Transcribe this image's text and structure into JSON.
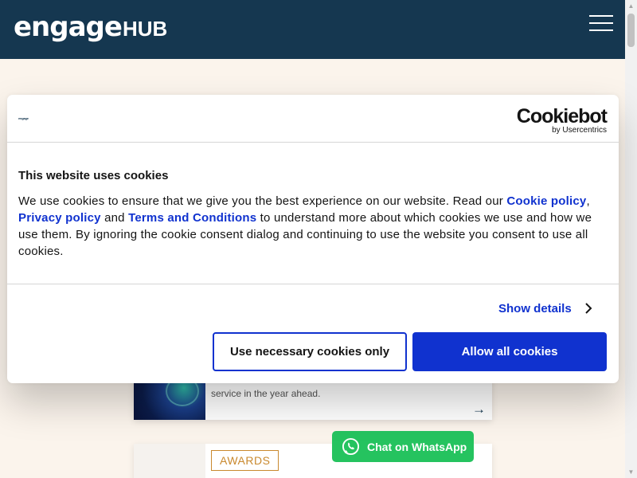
{
  "header": {
    "logo_main": "engage",
    "logo_hub": "HUB",
    "menu_icon": "hamburger-menu-icon"
  },
  "background": {
    "article_excerpt": "service in the year ahead.",
    "article_arrow": "→",
    "award_badge": "AWARDS"
  },
  "whatsapp": {
    "label": "Chat on WhatsApp",
    "icon": "whatsapp-icon",
    "color": "#25c35f"
  },
  "cookie_dialog": {
    "mini_logo": "engage",
    "brand_name": "Cookiebot",
    "brand_sub": "by Usercentrics",
    "title": "This website uses cookies",
    "text_intro": "We use cookies to ensure that we give you the best experience on our website. Read our ",
    "link_cookie_policy": "Cookie policy",
    "sep_comma": ", ",
    "link_privacy_policy": "Privacy policy",
    "sep_and": " and ",
    "link_terms": "Terms and Conditions",
    "text_rest": " to understand more about which cookies we use and how we use them. By ignoring the cookie consent dialog and continuing to use the website you consent to use all cookies.",
    "show_details": "Show details",
    "btn_necessary": "Use necessary cookies only",
    "btn_allow": "Allow all cookies",
    "accent_color": "#1032cf"
  },
  "colors": {
    "header_bg": "#153750",
    "page_bg": "#fbf4ec",
    "award_accent": "#c9892e"
  }
}
